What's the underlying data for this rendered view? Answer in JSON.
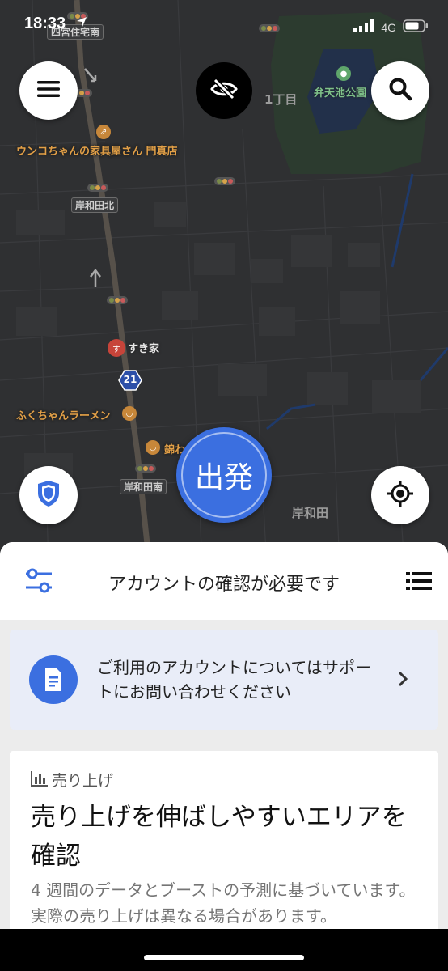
{
  "status_bar": {
    "time": "18:33",
    "network": "4G"
  },
  "map": {
    "labels": {
      "station_top": "四宮住宅南",
      "block": "1丁目",
      "park": "弁天池公園",
      "furniture_store": "ウンコちゃんの家具屋さん 門真店",
      "kishiwada_north": "岸和田北",
      "sukiya": "すき家",
      "route_number": "21",
      "ramen": "ふくちゃんラーメン",
      "nishiki": "錦わ",
      "kishiwada_south": "岸和田南",
      "kishiwada": "岸和田"
    }
  },
  "go_button": {
    "label": "出発"
  },
  "sheet": {
    "title": "アカウントの確認が必要です",
    "notice": {
      "text": "ご利用のアカウントについてはサポートにお問い合わせください"
    },
    "earnings": {
      "kicker": "売り上げ",
      "title": "売り上げを伸ばしやすいエリアを確認",
      "description": "4 週間のデータとブーストの予測に基づいています。実際の売り上げは異なる場合があります。"
    }
  },
  "colors": {
    "accent_blue": "#3b6fe0",
    "map_bg": "#2f3032",
    "notice_bg": "#e9edf8"
  },
  "icons": {
    "menu": "hamburger-icon",
    "search": "search-icon",
    "visibility": "eye-off-icon",
    "safety": "shield-icon",
    "locate": "crosshair-icon",
    "filter": "sliders-icon",
    "list": "list-icon",
    "notice": "document-icon",
    "chevron": "chevron-right-icon",
    "earnings": "bar-chart-icon"
  }
}
